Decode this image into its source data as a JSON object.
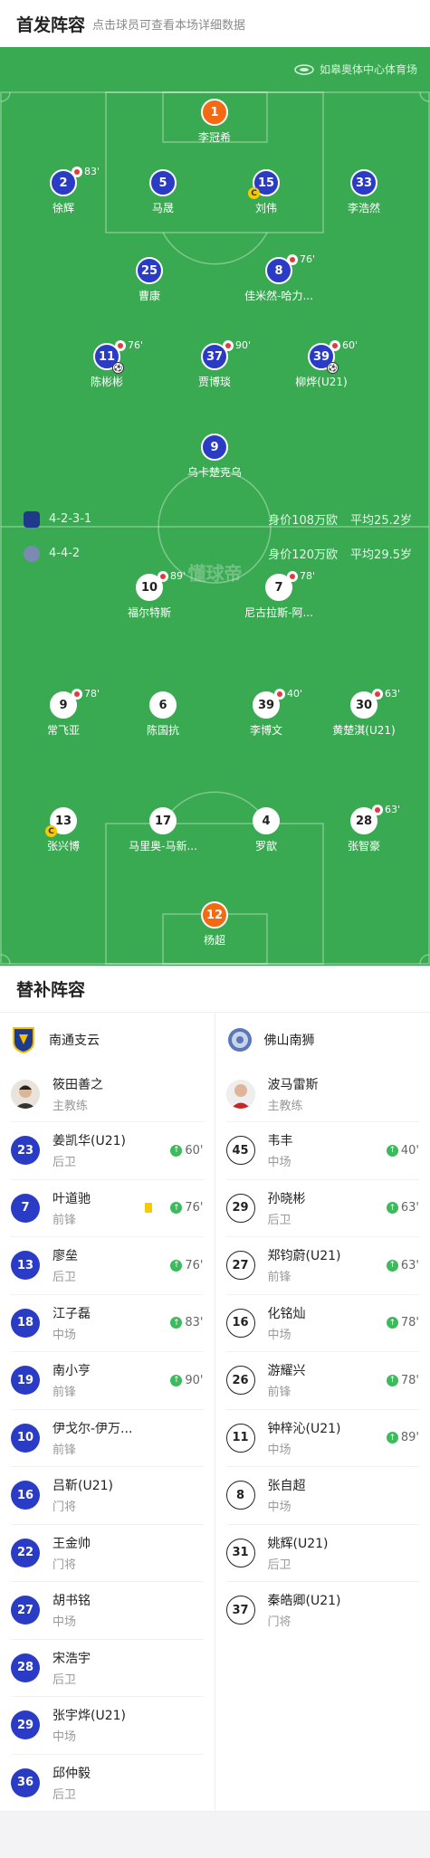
{
  "header": {
    "title": "首发阵容",
    "subtitle": "点击球员可查看本场详细数据"
  },
  "pitch": {
    "venue": "如皋奥体中心体育场",
    "watermark": "懂球帝",
    "home_formation": "4-2-3-1",
    "home_value": "身价108万欧",
    "home_age": "平均25.2岁",
    "away_formation": "4-4-2",
    "away_value": "身价120万欧",
    "away_age": "平均29.5岁",
    "home": [
      {
        "num": "1",
        "name": "李冠希",
        "gk": true
      },
      {
        "num": "2",
        "name": "徐辉",
        "sub": "83'"
      },
      {
        "num": "5",
        "name": "马晟"
      },
      {
        "num": "15",
        "name": "刘伟",
        "captain": "C"
      },
      {
        "num": "33",
        "name": "李浩然"
      },
      {
        "num": "25",
        "name": "曹康"
      },
      {
        "num": "8",
        "name": "佳米然-哈力...",
        "sub": "76'"
      },
      {
        "num": "11",
        "name": "陈彬彬",
        "sub": "76'",
        "goal": true
      },
      {
        "num": "37",
        "name": "贾博琰",
        "sub": "90'"
      },
      {
        "num": "39",
        "name": "柳烨(U21)",
        "sub": "60'",
        "goal": true
      },
      {
        "num": "9",
        "name": "乌卡楚克乌"
      }
    ],
    "away": [
      {
        "num": "10",
        "name": "福尔特斯",
        "sub": "89'"
      },
      {
        "num": "7",
        "name": "尼古拉斯-阿...",
        "sub": "78'"
      },
      {
        "num": "9",
        "name": "常飞亚",
        "sub": "78'"
      },
      {
        "num": "6",
        "name": "陈国抗"
      },
      {
        "num": "39",
        "name": "李博文",
        "sub": "40'"
      },
      {
        "num": "30",
        "name": "黄楚淇(U21)",
        "sub": "63'"
      },
      {
        "num": "13",
        "name": "张兴博",
        "captain": "C"
      },
      {
        "num": "17",
        "name": "马里奥-马新..."
      },
      {
        "num": "4",
        "name": "罗歆"
      },
      {
        "num": "28",
        "name": "张智豪",
        "sub": "63'"
      },
      {
        "num": "12",
        "name": "杨超",
        "gk": true
      }
    ]
  },
  "subs": {
    "title": "替补阵容",
    "home": {
      "team": "南通支云",
      "coach": "筱田善之",
      "coach_role": "主教练",
      "players": [
        {
          "num": "23",
          "name": "姜凯华(U21)",
          "pos": "后卫",
          "in": "60'"
        },
        {
          "num": "7",
          "name": "叶道驰",
          "pos": "前锋",
          "in": "76'",
          "yellow": true
        },
        {
          "num": "13",
          "name": "廖垒",
          "pos": "后卫",
          "in": "76'"
        },
        {
          "num": "18",
          "name": "江子磊",
          "pos": "中场",
          "in": "83'"
        },
        {
          "num": "19",
          "name": "南小亨",
          "pos": "前锋",
          "in": "90'"
        },
        {
          "num": "10",
          "name": "伊戈尔-伊万...",
          "pos": "前锋"
        },
        {
          "num": "16",
          "name": "吕靳(U21)",
          "pos": "门将"
        },
        {
          "num": "22",
          "name": "王金帅",
          "pos": "门将"
        },
        {
          "num": "27",
          "name": "胡书铭",
          "pos": "中场"
        },
        {
          "num": "28",
          "name": "宋浩宇",
          "pos": "后卫"
        },
        {
          "num": "29",
          "name": "张宇烨(U21)",
          "pos": "中场"
        },
        {
          "num": "36",
          "name": "邱仲毅",
          "pos": "后卫"
        }
      ]
    },
    "away": {
      "team": "佛山南狮",
      "coach": "波马雷斯",
      "coach_role": "主教练",
      "players": [
        {
          "num": "45",
          "name": "韦丰",
          "pos": "中场",
          "in": "40'"
        },
        {
          "num": "29",
          "name": "孙晓彬",
          "pos": "后卫",
          "in": "63'"
        },
        {
          "num": "27",
          "name": "郑钧蔚(U21)",
          "pos": "前锋",
          "in": "63'"
        },
        {
          "num": "16",
          "name": "化铭灿",
          "pos": "中场",
          "in": "78'"
        },
        {
          "num": "26",
          "name": "游耀兴",
          "pos": "前锋",
          "in": "78'"
        },
        {
          "num": "11",
          "name": "钟梓沁(U21)",
          "pos": "中场",
          "in": "89'"
        },
        {
          "num": "8",
          "name": "张自超",
          "pos": "中场"
        },
        {
          "num": "31",
          "name": "姚辉(U21)",
          "pos": "后卫"
        },
        {
          "num": "37",
          "name": "秦皓卿(U21)",
          "pos": "门将"
        }
      ]
    }
  },
  "colors": {
    "pitch": "#3aaa52",
    "home": "#2a3cc6",
    "gk": "#f46a12",
    "sub_in": "#3dbb5c",
    "sub_out": "#e23b3b"
  }
}
